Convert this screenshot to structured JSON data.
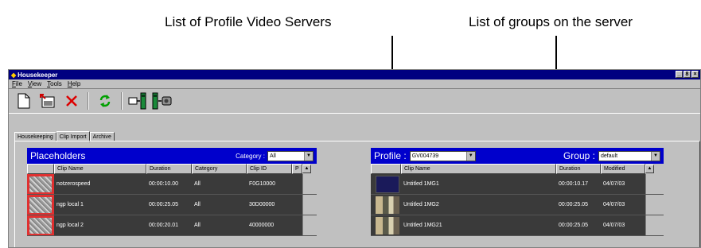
{
  "callouts": {
    "profile_servers": "List of Profile Video Servers",
    "groups": "List of groups on the server"
  },
  "window": {
    "title": "Housekeeper",
    "controls": [
      "_",
      "8",
      "×"
    ]
  },
  "menu": [
    "File",
    "View",
    "Tools",
    "Help"
  ],
  "toolbar": {
    "icons": [
      "new-document-icon",
      "import-clip-icon",
      "delete-icon",
      "refresh-icon",
      "export-to-server-icon",
      "server-to-archive-icon"
    ]
  },
  "tabs": [
    "Housekeeping",
    "Clip Import",
    "Archive"
  ],
  "placeholders": {
    "title": "Placeholders",
    "category_label": "Category :",
    "category_value": "All",
    "columns": [
      "",
      "Clip Name",
      "Duration",
      "Category",
      "Clip ID",
      "P"
    ],
    "rows": [
      {
        "name": "notzerospeed",
        "duration": "00:00:10.00",
        "category": "All",
        "clip_id": "F0G10000"
      },
      {
        "name": "ngp local 1",
        "duration": "00:00:25.05",
        "category": "All",
        "clip_id": "30D00000"
      },
      {
        "name": "ngp local 2",
        "duration": "00:00:20.01",
        "category": "All",
        "clip_id": "40000000"
      }
    ]
  },
  "server": {
    "profile_label": "Profile :",
    "profile_value": "GV004739",
    "group_label": "Group :",
    "group_value": "default",
    "columns": [
      "",
      "Clip Name",
      "Duration",
      "Modified"
    ],
    "rows": [
      {
        "name": "Untitled 1MG1",
        "duration": "00:00:10.17",
        "modified": "04/07/03"
      },
      {
        "name": "Untitled 1MG2",
        "duration": "00:00:25.05",
        "modified": "04/07/03"
      },
      {
        "name": "Untitled 1MG21",
        "duration": "00:00:25.05",
        "modified": "04/07/03"
      }
    ]
  }
}
